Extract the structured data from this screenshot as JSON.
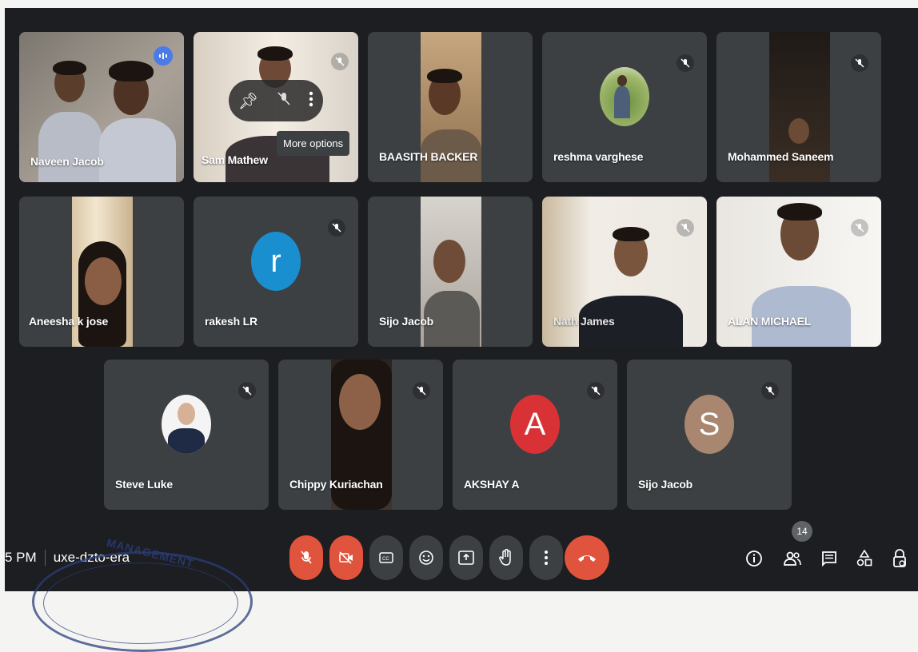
{
  "participants": [
    {
      "name": "Naveen Jacob"
    },
    {
      "name": "Sam Mathew"
    },
    {
      "name": "BAASITH BACKER"
    },
    {
      "name": "reshma varghese"
    },
    {
      "name": "Mohammed Saneem"
    },
    {
      "name": "Aneesha k jose"
    },
    {
      "name": "rakesh LR",
      "initial": "r"
    },
    {
      "name": "Sijo Jacob"
    },
    {
      "name": "Nath James"
    },
    {
      "name": "ALAN MICHAEL"
    },
    {
      "name": "Steve Luke"
    },
    {
      "name": "Chippy Kuriachan"
    },
    {
      "name": "AKSHAY A",
      "initial": "A"
    },
    {
      "name": "Sijo Jacob",
      "initial": "S"
    }
  ],
  "tooltip": "More options",
  "clock": {
    "time": "5 PM",
    "meeting_code": "uxe-dzto-era"
  },
  "participant_count": "14",
  "stamp_text": "MANAGEMENT",
  "colors": {
    "background": "#1d1e21",
    "tile": "#3c4043",
    "danger": "#e0533c",
    "avatar_blue": "#1a8fd0",
    "avatar_red": "#d93236",
    "avatar_brown": "#a9866f"
  },
  "icons": {
    "mic": "mic-off-icon",
    "camera": "camera-off-icon",
    "captions": "captions-icon",
    "emoji": "emoji-icon",
    "present": "present-icon",
    "hand": "raise-hand-icon",
    "more": "more-vert-icon",
    "leave": "call-end-icon",
    "info": "info-icon",
    "people": "people-icon",
    "chat": "chat-icon",
    "activities": "activities-icon",
    "lock": "host-controls-icon"
  }
}
